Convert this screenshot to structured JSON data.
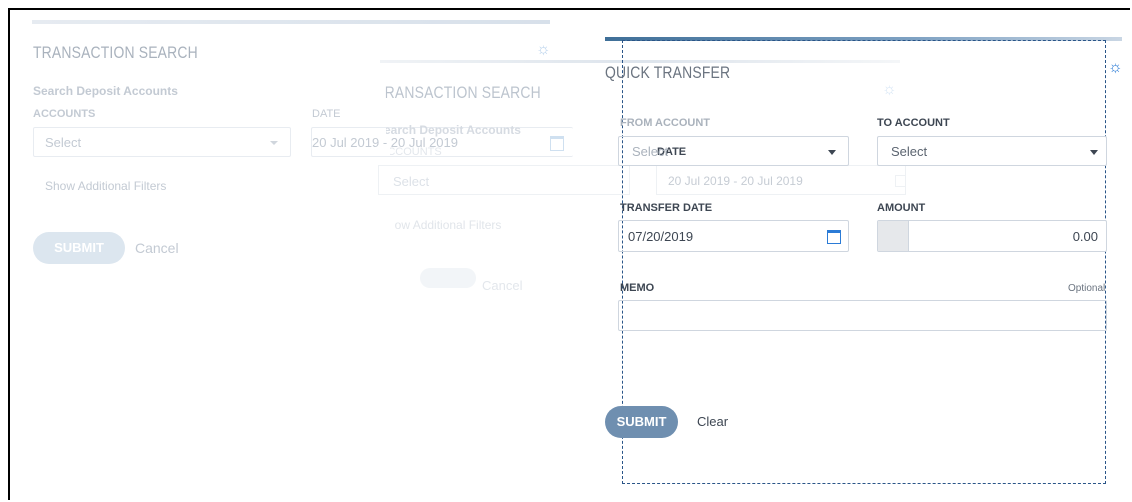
{
  "left_panel": {
    "title": "TRANSACTION SEARCH",
    "subtitle": "Search Deposit Accounts",
    "accounts_label": "ACCOUNTS",
    "accounts_value": "Select",
    "date_label": "DATE",
    "date_value": "20 Jul 2019 - 20 Jul 2019",
    "show_filters": "Show Additional Filters",
    "submit": "SUBMIT",
    "cancel": "Cancel"
  },
  "ghost_panel": {
    "title": "TRANSACTION SEARCH",
    "subtitle": "Search Deposit Accounts",
    "accounts_label": "ACCOUNTS",
    "accounts_value": "Select",
    "date_label": "DATE",
    "date_value": "20 Jul 2019 - 20 Jul 2019",
    "show_filters": "Show Additional Filters",
    "cancel": "Cancel"
  },
  "quick_transfer": {
    "title": "QUICK TRANSFER",
    "from_label": "FROM ACCOUNT",
    "from_value": "Select",
    "to_label": "TO ACCOUNT",
    "to_value": "Select",
    "transfer_date_label": "TRANSFER DATE",
    "transfer_date_value": "07/20/2019",
    "amount_label": "AMOUNT",
    "amount_value": "0.00",
    "memo_label": "MEMO",
    "memo_hint": "Optional",
    "submit": "SUBMIT",
    "clear": "Clear"
  },
  "colors": {
    "faint_text": "#c3cad3",
    "ghost_text": "#dde2e8",
    "label_dark": "#3d4652",
    "accent_blue": "#6f8fb0",
    "faint_button": "#dce6ef",
    "dash_border": "#2a5588",
    "gear_blue": "#2b7bd6"
  },
  "icons": [
    "gear-icon",
    "calendar-icon",
    "chevron-down-icon"
  ]
}
